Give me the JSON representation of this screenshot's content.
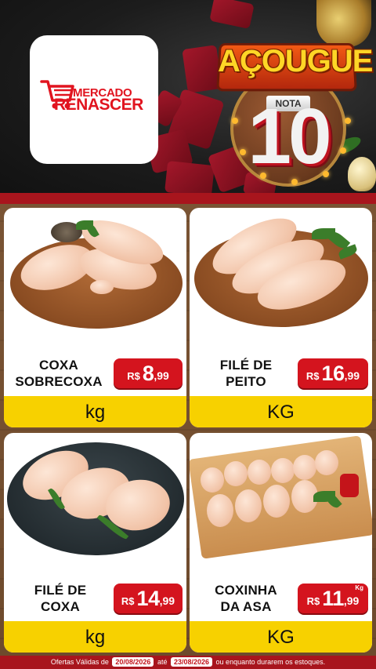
{
  "brand": {
    "line1": "MERCADO",
    "line2": "RENASCER",
    "logo_icon": "shopping-cart-icon"
  },
  "campaign": {
    "title": "AÇOUGUE",
    "subtitle": "NOTA",
    "score": "10"
  },
  "products": [
    {
      "name_line1": "COXA",
      "name_line2": "SOBRECOXA",
      "currency": "R$",
      "price_int": "8",
      "price_cents": ",99",
      "unit": "kg"
    },
    {
      "name_line1": "FILÉ DE",
      "name_line2": "PEITO",
      "currency": "R$",
      "price_int": "16",
      "price_cents": ",99",
      "unit": "KG"
    },
    {
      "name_line1": "FILÉ DE",
      "name_line2": "COXA",
      "currency": "R$",
      "price_int": "14",
      "price_cents": ",99",
      "unit": "kg"
    },
    {
      "name_line1": "COXINHA",
      "name_line2": "DA ASA",
      "currency": "R$",
      "price_int": "11",
      "price_cents": ",99",
      "price_unit_mini": "Kg",
      "unit": "KG"
    }
  ],
  "footer": {
    "prefix": "Ofertas Válidas de",
    "date_start": "20/08/2026",
    "middle": "até",
    "date_end": "23/08/2026",
    "suffix": "ou enquanto durarem os estoques."
  },
  "colors": {
    "brand_red": "#e1141f",
    "price_red": "#d4141e",
    "unit_yellow": "#f7d100",
    "footer_red": "#a8151d"
  }
}
